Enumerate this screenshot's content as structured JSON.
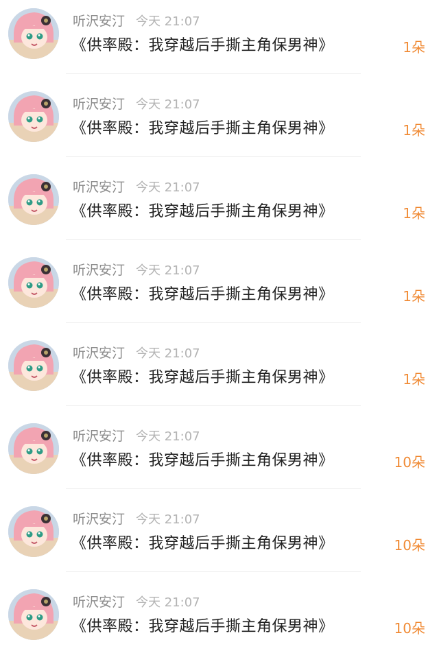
{
  "colors": {
    "name": "#8a8a8a",
    "time": "#b3b3b3",
    "title": "#222222",
    "count": "#f08a34",
    "divider": "#eeeeee"
  },
  "list": {
    "items": [
      {
        "user": "听沢安汀",
        "time": "今天 21:07",
        "title": "《供率殿：我穿越后手撕主角保男神》",
        "count": "1朵",
        "avatar_icon": "anime-girl-avatar-icon"
      },
      {
        "user": "听沢安汀",
        "time": "今天 21:07",
        "title": "《供率殿：我穿越后手撕主角保男神》",
        "count": "1朵",
        "avatar_icon": "anime-girl-avatar-icon"
      },
      {
        "user": "听沢安汀",
        "time": "今天 21:07",
        "title": "《供率殿：我穿越后手撕主角保男神》",
        "count": "1朵",
        "avatar_icon": "anime-girl-avatar-icon"
      },
      {
        "user": "听沢安汀",
        "time": "今天 21:07",
        "title": "《供率殿：我穿越后手撕主角保男神》",
        "count": "1朵",
        "avatar_icon": "anime-girl-avatar-icon"
      },
      {
        "user": "听沢安汀",
        "time": "今天 21:07",
        "title": "《供率殿：我穿越后手撕主角保男神》",
        "count": "1朵",
        "avatar_icon": "anime-girl-avatar-icon"
      },
      {
        "user": "听沢安汀",
        "time": "今天 21:07",
        "title": "《供率殿：我穿越后手撕主角保男神》",
        "count": "10朵",
        "avatar_icon": "anime-girl-avatar-icon"
      },
      {
        "user": "听沢安汀",
        "time": "今天 21:07",
        "title": "《供率殿：我穿越后手撕主角保男神》",
        "count": "10朵",
        "avatar_icon": "anime-girl-avatar-icon"
      },
      {
        "user": "听沢安汀",
        "time": "今天 21:07",
        "title": "《供率殿：我穿越后手撕主角保男神》",
        "count": "10朵",
        "avatar_icon": "anime-girl-avatar-icon"
      }
    ]
  }
}
